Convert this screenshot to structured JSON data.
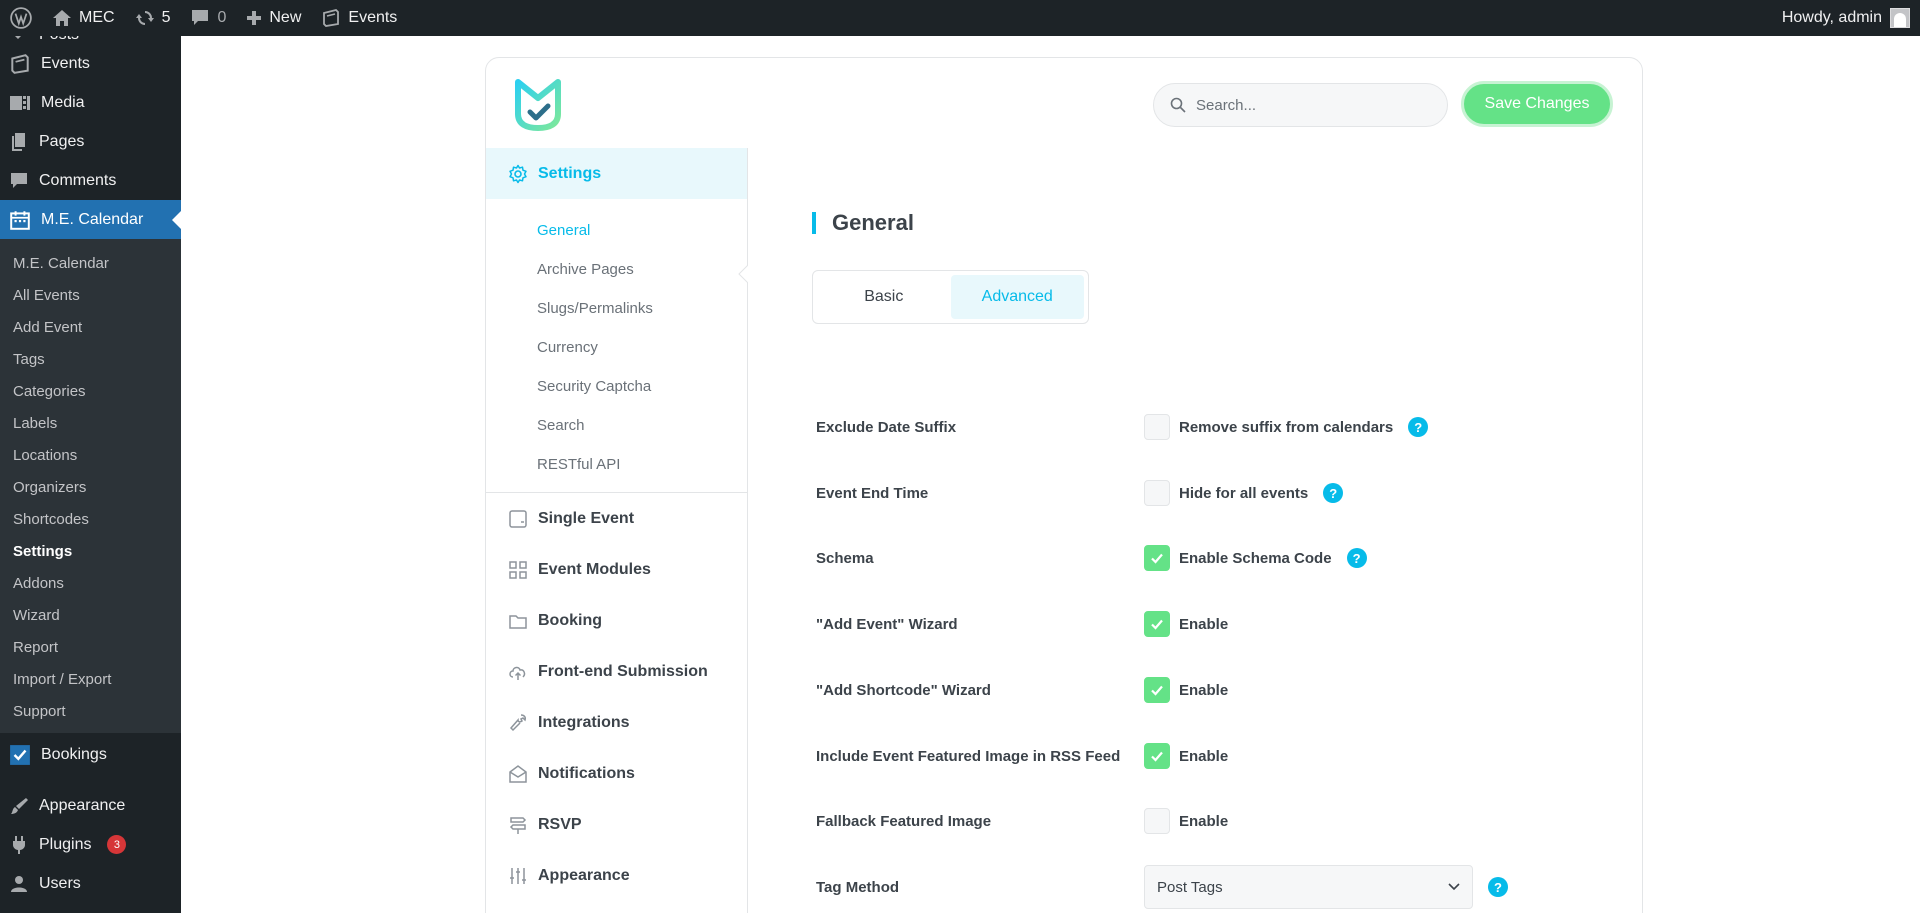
{
  "adminbar": {
    "site_name": "MEC",
    "updates_count": "5",
    "comments_count": "0",
    "new_label": "New",
    "events_label": "Events",
    "howdy": "Howdy, admin"
  },
  "sidebar": {
    "top_items": [
      {
        "label": "Posts"
      },
      {
        "label": "Events"
      },
      {
        "label": "Media"
      },
      {
        "label": "Pages"
      },
      {
        "label": "Comments"
      },
      {
        "label": "M.E. Calendar"
      }
    ],
    "submenu": [
      {
        "label": "M.E. Calendar"
      },
      {
        "label": "All Events"
      },
      {
        "label": "Add Event"
      },
      {
        "label": "Tags"
      },
      {
        "label": "Categories"
      },
      {
        "label": "Labels"
      },
      {
        "label": "Locations"
      },
      {
        "label": "Organizers"
      },
      {
        "label": "Shortcodes"
      },
      {
        "label": "Settings"
      },
      {
        "label": "Addons"
      },
      {
        "label": "Wizard"
      },
      {
        "label": "Report"
      },
      {
        "label": "Import / Export"
      },
      {
        "label": "Support"
      }
    ],
    "bottom_items": [
      {
        "label": "Bookings"
      },
      {
        "label": "Appearance"
      },
      {
        "label": "Plugins",
        "badge": "3"
      },
      {
        "label": "Users"
      }
    ]
  },
  "header": {
    "search_placeholder": "Search...",
    "save_label": "Save Changes"
  },
  "settings_nav": {
    "settings_label": "Settings",
    "sub_items": [
      {
        "label": "General"
      },
      {
        "label": "Archive Pages"
      },
      {
        "label": "Slugs/Permalinks"
      },
      {
        "label": "Currency"
      },
      {
        "label": "Security Captcha"
      },
      {
        "label": "Search"
      },
      {
        "label": "RESTful API"
      }
    ],
    "items": [
      {
        "label": "Single Event"
      },
      {
        "label": "Event Modules"
      },
      {
        "label": "Booking"
      },
      {
        "label": "Front-end Submission"
      },
      {
        "label": "Integrations"
      },
      {
        "label": "Notifications"
      },
      {
        "label": "RSVP"
      },
      {
        "label": "Appearance"
      }
    ]
  },
  "main": {
    "title": "General",
    "tabs": [
      {
        "label": "Basic"
      },
      {
        "label": "Advanced"
      }
    ],
    "rows": [
      {
        "label": "Exclude Date Suffix",
        "control": "Remove suffix from calendars",
        "checked": false
      },
      {
        "label": "Event End Time",
        "control": "Hide for all events",
        "checked": false
      },
      {
        "label": "Schema",
        "control": "Enable Schema Code",
        "checked": true
      },
      {
        "label": "\"Add Event\" Wizard",
        "control": "Enable",
        "checked": true
      },
      {
        "label": "\"Add Shortcode\" Wizard",
        "control": "Enable",
        "checked": true
      },
      {
        "label": "Include Event Featured Image in RSS Feed",
        "control": "Enable",
        "checked": true
      },
      {
        "label": "Fallback Featured Image",
        "control": "Enable",
        "checked": false
      },
      {
        "label": "Tag Method",
        "select_value": "Post Tags"
      }
    ],
    "help_glyph": "?"
  },
  "colors": {
    "accent": "#07bbe9",
    "success": "#64e287",
    "admin_dark": "#1d2327",
    "admin_blue": "#2271b1"
  }
}
